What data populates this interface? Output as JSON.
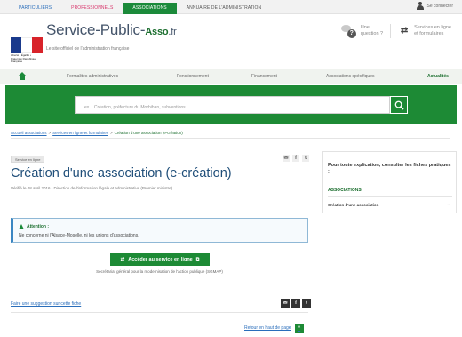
{
  "topnav": {
    "tabs": [
      {
        "label": "Particuliers"
      },
      {
        "label": "Professionnels"
      },
      {
        "label": "Associations"
      },
      {
        "label": "Annuaire de l'administration"
      }
    ],
    "connect_label": "Se connecter"
  },
  "header": {
    "flag_text": "Liberté • Égalité • Fraternité République Française",
    "brand_main": "Service-Public-",
    "brand_asso": "Asso",
    "brand_suffix": ".fr",
    "tagline": "Le site officiel de l'administration française",
    "question_label_1": "Une",
    "question_label_2": "question ?",
    "services_label_1": "Services en ligne",
    "services_label_2": "et formulaires"
  },
  "navbar": {
    "items": [
      {
        "label": "Formalités administratives"
      },
      {
        "label": "Fonctionnement"
      },
      {
        "label": "Financement"
      },
      {
        "label": "Associations spécifiques"
      },
      {
        "label": "Actualités"
      }
    ]
  },
  "search": {
    "placeholder": "ex. : Création, préfecture du Morbihan, subventions..."
  },
  "breadcrumb": {
    "home": "Accueil associations",
    "level2": "Services en ligne et formulaires",
    "current": "Création d'une association (e-création)"
  },
  "main": {
    "badge": "Service en ligne",
    "title": "Création d'une association (e-création)",
    "verified": "Vérifié le 08 avril 2016 - Direction de l'information légale et administrative (Premier ministre)",
    "alert_title": "Attention :",
    "alert_text": "Ne concerne ni l'Alsace-Moselle, ni les unions d'associations.",
    "cta_label": "Accéder au service en ligne",
    "provider": "Secrétariat général pour la modernisation de l'action publique (SGMAP)",
    "suggest_label": "Faire une suggestion sur cette fiche",
    "back_to_top": "Retour en haut de page"
  },
  "sidebar": {
    "title": "Pour toute explication, consulter les fiches pratiques :",
    "category": "Associations",
    "item": "Création d'une association"
  }
}
